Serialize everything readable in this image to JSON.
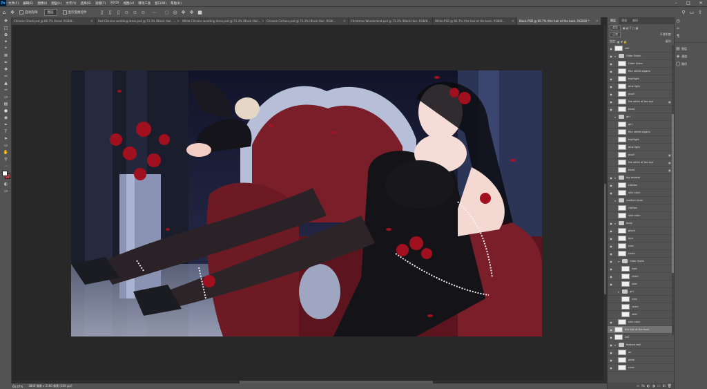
{
  "menu": {
    "app_logo": "Ps",
    "items": [
      "文件(F)",
      "编辑(E)",
      "图像(I)",
      "图层(L)",
      "文字(Y)",
      "选择(S)",
      "滤镜(T)",
      "3D(D)",
      "视图(V)",
      "增效工具",
      "窗口(W)",
      "帮助(H)"
    ]
  },
  "options": {
    "auto_select_label": "自动选择:",
    "auto_select_value": "图层",
    "transform_label": "显示变换控件"
  },
  "tabs": [
    {
      "label": "Chinese Ghost.psd @ 66.7% (head, RGB/8...",
      "active": false
    },
    {
      "label": "Red Chinese wedding dress.psd @ 73.3% (Black Hair, ...",
      "active": false
    },
    {
      "label": "White Chinese wedding dress.psd @ 73.3% (Black Hair...",
      "active": false
    },
    {
      "label": "Chinese Cartoon.psd @ 73.3% (Black Hair, RGB/...",
      "active": false
    },
    {
      "label": "Christmas Wonderland.psd @ 73.3% (Black Hair, RGB/8...",
      "active": false
    },
    {
      "label": "White.PSD @ 66.7% (the hair at the back, RGB/8...",
      "active": false
    },
    {
      "label": "Black.PSD @ 66.7% (the hair at the back, RGB/8) *",
      "active": true
    }
  ],
  "status": {
    "zoom": "66.67%",
    "doc_info": "3840 像素 x 2160 像素 (300 ppi)"
  },
  "layers_panel": {
    "tabs": [
      "图层",
      "通道",
      "路径"
    ],
    "filter_label": "类型",
    "blend_mode": "正常",
    "opacity_label": "不透明度:",
    "lock_label": "锁定:",
    "fill_label": "填充:",
    "rows": [
      {
        "name": "veil",
        "type": "layer",
        "indent": 0,
        "visible": true
      },
      {
        "name": "Older Sister",
        "type": "group",
        "indent": 0,
        "visible": true
      },
      {
        "name": "Older Sister",
        "type": "layer",
        "indent": 1,
        "visible": true
      },
      {
        "name": "five sense organs",
        "type": "layer",
        "indent": 1,
        "visible": true
      },
      {
        "name": "highlight",
        "type": "layer",
        "indent": 1,
        "visible": true
      },
      {
        "name": "blue light",
        "type": "layer",
        "indent": 1,
        "visible": true
      },
      {
        "name": "pupil",
        "type": "layer",
        "indent": 1,
        "visible": true
      },
      {
        "name": "the white of the eye",
        "type": "layer",
        "indent": 1,
        "visible": true,
        "locked": true
      },
      {
        "name": "head",
        "type": "layer",
        "indent": 1,
        "visible": true
      },
      {
        "name": "girl",
        "type": "group",
        "indent": 0,
        "visible": false
      },
      {
        "name": "girl",
        "type": "layer",
        "indent": 1,
        "visible": false
      },
      {
        "name": "five sense organs",
        "type": "layer",
        "indent": 1,
        "visible": false
      },
      {
        "name": "highlight",
        "type": "layer",
        "indent": 1,
        "visible": false
      },
      {
        "name": "blue light",
        "type": "layer",
        "indent": 1,
        "visible": false
      },
      {
        "name": "pupil",
        "type": "layer",
        "indent": 1,
        "visible": false,
        "locked": true
      },
      {
        "name": "the white of the eye",
        "type": "layer",
        "indent": 1,
        "visible": false,
        "locked": true
      },
      {
        "name": "head",
        "type": "layer",
        "indent": 1,
        "visible": false,
        "locked": true
      },
      {
        "name": "big breasts",
        "type": "group",
        "indent": 0,
        "visible": true
      },
      {
        "name": "clothes",
        "type": "layer",
        "indent": 1,
        "visible": true
      },
      {
        "name": "skin color",
        "type": "layer",
        "indent": 1,
        "visible": true
      },
      {
        "name": "medium bust",
        "type": "group",
        "indent": 0,
        "visible": false
      },
      {
        "name": "clothes",
        "type": "layer",
        "indent": 1,
        "visible": false
      },
      {
        "name": "skin color",
        "type": "layer",
        "indent": 1,
        "visible": false
      },
      {
        "name": "body",
        "type": "group",
        "indent": 0,
        "visible": true
      },
      {
        "name": "glove",
        "type": "layer",
        "indent": 1,
        "visible": true
      },
      {
        "name": "lace",
        "type": "layer",
        "indent": 1,
        "visible": true
      },
      {
        "name": "rose",
        "type": "layer",
        "indent": 1,
        "visible": true
      },
      {
        "name": "chain",
        "type": "layer",
        "indent": 1,
        "visible": true
      },
      {
        "name": "Older Sister",
        "type": "group",
        "indent": 1,
        "visible": true
      },
      {
        "name": "rose",
        "type": "layer",
        "indent": 2,
        "visible": true
      },
      {
        "name": "chain",
        "type": "layer",
        "indent": 2,
        "visible": true
      },
      {
        "name": "skirt",
        "type": "layer",
        "indent": 2,
        "visible": true
      },
      {
        "name": "girl",
        "type": "group",
        "indent": 1,
        "visible": false
      },
      {
        "name": "rose",
        "type": "layer",
        "indent": 2,
        "visible": false
      },
      {
        "name": "chain",
        "type": "layer",
        "indent": 2,
        "visible": false
      },
      {
        "name": "skirt",
        "type": "layer",
        "indent": 2,
        "visible": false
      },
      {
        "name": "skin color",
        "type": "layer",
        "indent": 1,
        "visible": true
      },
      {
        "name": "the hair at the back",
        "type": "layer",
        "indent": 0,
        "visible": true,
        "selected": true
      },
      {
        "name": "veil",
        "type": "layer",
        "indent": 0,
        "visible": true
      },
      {
        "name": "feature wall",
        "type": "group",
        "indent": 0,
        "visible": true
      },
      {
        "name": "air",
        "type": "layer",
        "indent": 1,
        "visible": true
      },
      {
        "name": "petal",
        "type": "layer",
        "indent": 1,
        "visible": true
      },
      {
        "name": "chair",
        "type": "layer",
        "indent": 1,
        "visible": true
      }
    ]
  },
  "dock": {
    "items": [
      {
        "icon": "history-icon",
        "label": ""
      },
      {
        "icon": "brush-icon",
        "label": ""
      },
      {
        "icon": "paragraph-icon",
        "label": ""
      },
      {
        "icon": "layers-icon",
        "label": "图层"
      },
      {
        "icon": "channels-icon",
        "label": "通道"
      },
      {
        "icon": "paths-icon",
        "label": "路径"
      }
    ]
  },
  "artwork": {
    "description_colors": {
      "bg": "#1b1f33",
      "chair": "#7a1e2a",
      "frame": "#b7bfd8",
      "skin": "#f6dcd6",
      "dress": "#141418",
      "rose": "#a0101e"
    }
  }
}
